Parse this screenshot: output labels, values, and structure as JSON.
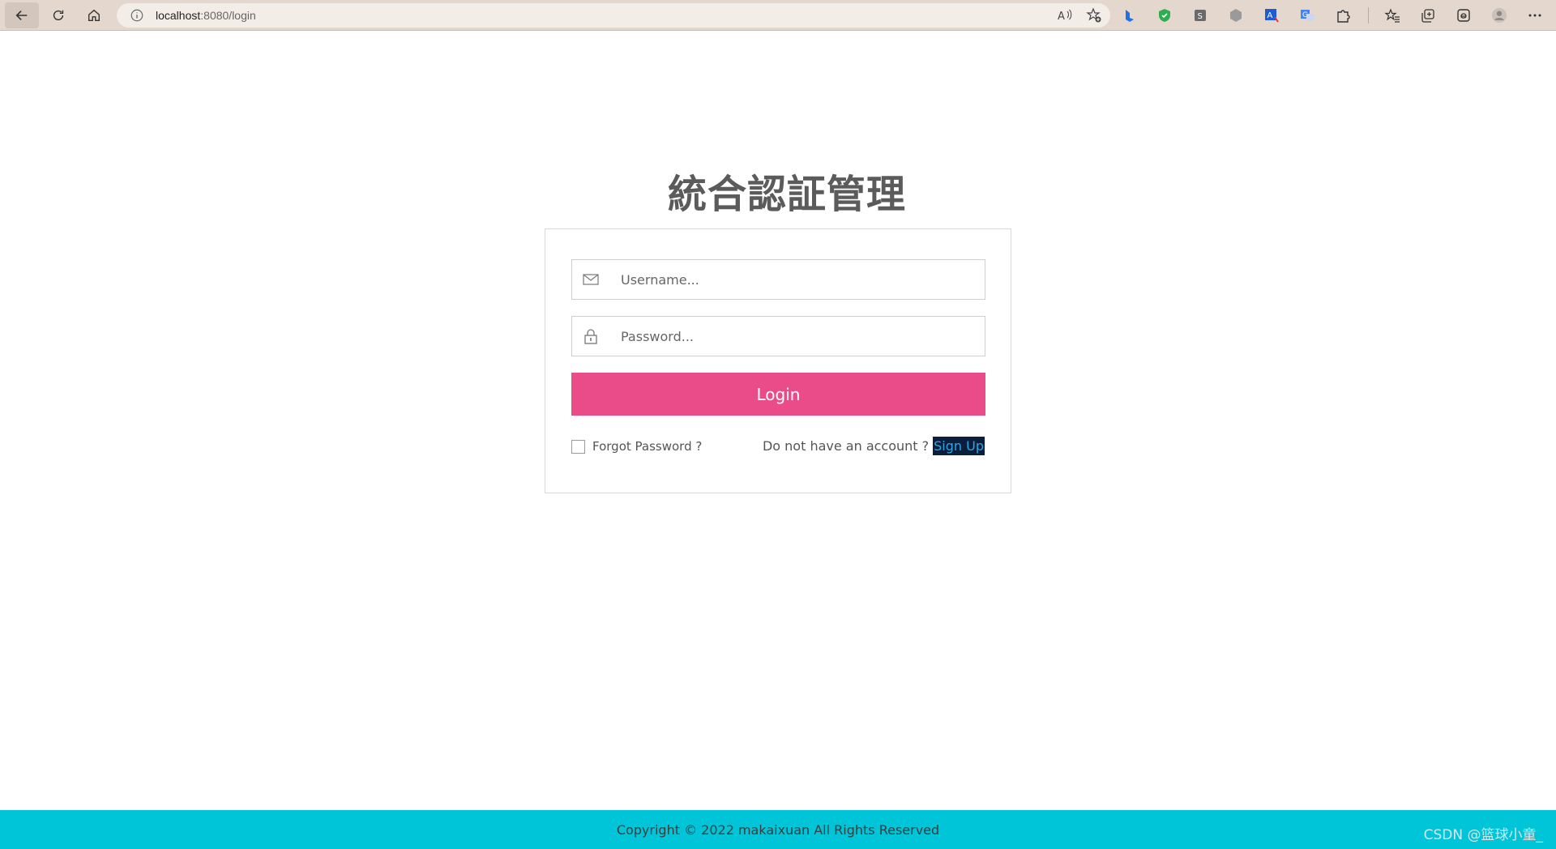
{
  "browser": {
    "url_host": "localhost",
    "url_rest": ":8080/login"
  },
  "login": {
    "title": "統合認証管理",
    "username_placeholder": "Username...",
    "password_placeholder": "Password...",
    "login_label": "Login",
    "forgot_label": "Forgot Password ?",
    "no_account_text": "Do not have an account ?",
    "signup_label": "Sign Up"
  },
  "footer": {
    "copyright": "Copyright © 2022 makaixuan All Rights Reserved"
  },
  "watermark": "CSDN @篮球小童_",
  "colors": {
    "accent": "#ea4c89",
    "footer": "#00c4d8",
    "chrome": "#e3d7ce"
  }
}
